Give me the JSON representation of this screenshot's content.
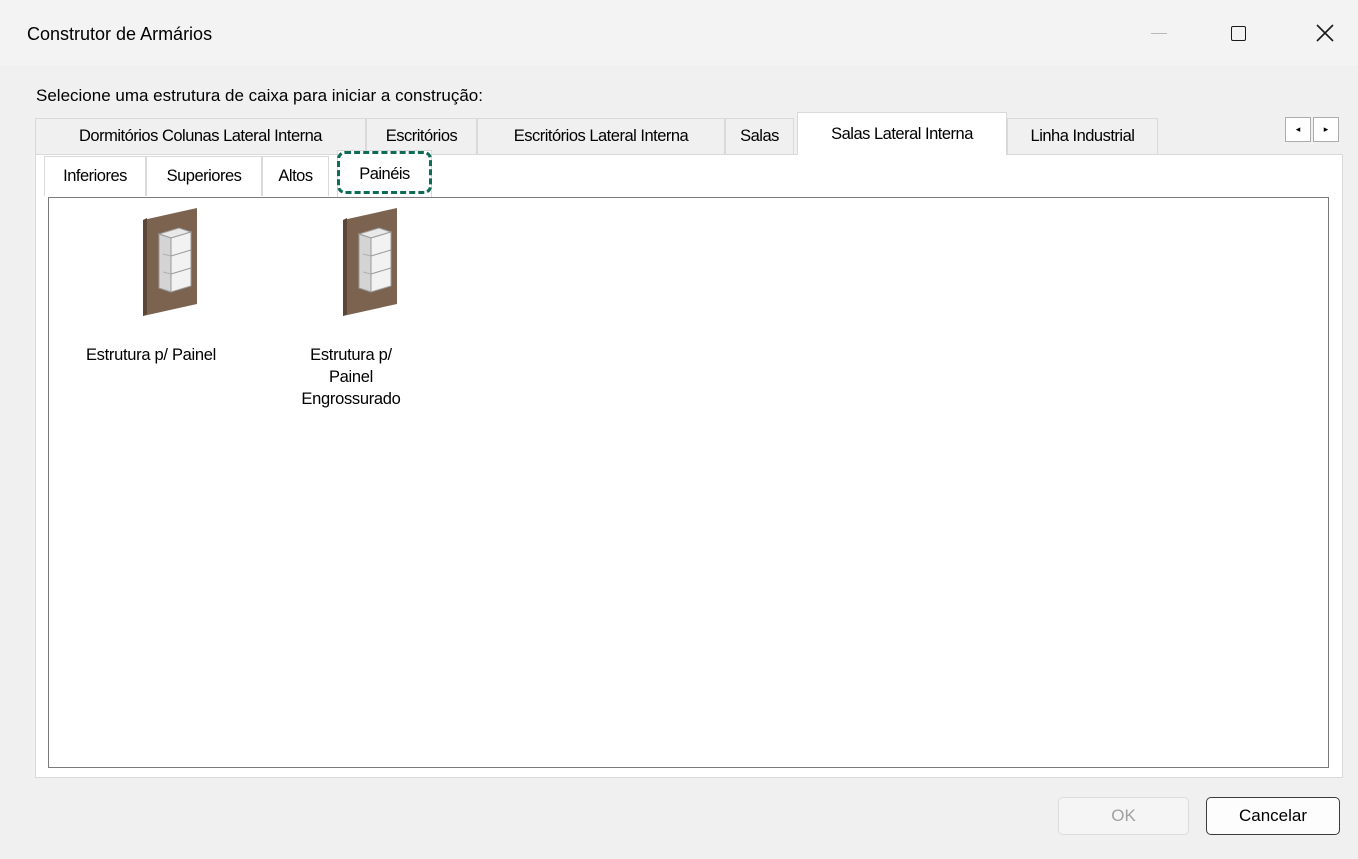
{
  "window": {
    "title": "Construtor de Armários",
    "minimize_icon": "minimize-icon",
    "maximize_icon": "maximize-icon",
    "close_icon": "close-icon"
  },
  "prompt": "Selecione uma estrutura de caixa para iniciar a construção:",
  "outer_tabs": [
    {
      "label": "Dormitórios Colunas Lateral Interna"
    },
    {
      "label": "Escritórios"
    },
    {
      "label": "Escritórios Lateral Interna"
    },
    {
      "label": "Salas"
    },
    {
      "label": "Salas Lateral Interna",
      "selected": true
    },
    {
      "label": "Linha Industrial"
    }
  ],
  "tab_scroll": {
    "left": "◂",
    "right": "▸"
  },
  "inner_tabs": [
    {
      "label": "Inferiores"
    },
    {
      "label": "Superiores"
    },
    {
      "label": "Altos"
    },
    {
      "label": "Painéis",
      "selected": true
    }
  ],
  "items": [
    {
      "label": "Estrutura p/ Painel",
      "icon": "panel-cabinet-icon"
    },
    {
      "label": "Estrutura p/ Painel Engrossurado",
      "icon": "panel-cabinet-icon"
    }
  ],
  "buttons": {
    "ok": {
      "label": "OK",
      "enabled": false
    },
    "cancel": {
      "label": "Cancelar",
      "enabled": true
    }
  },
  "colors": {
    "highlight": "#0e6b55",
    "wood": "#7b6350"
  }
}
